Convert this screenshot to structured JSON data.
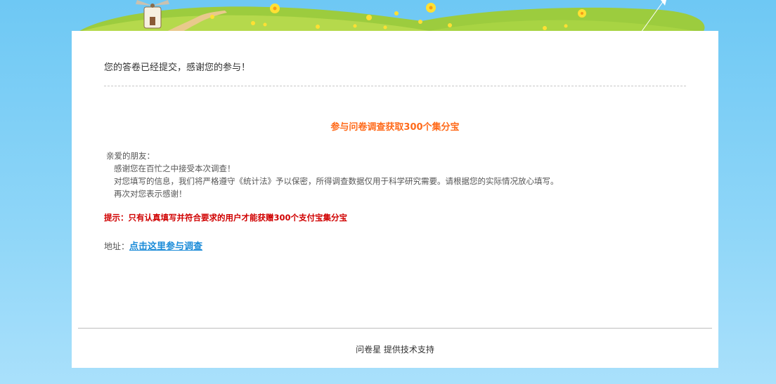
{
  "confirmation": {
    "message": "您的答卷已经提交，感谢您的参与！"
  },
  "promo": {
    "title": "参与问卷调查获取300个集分宝",
    "greeting": "亲爱的朋友：",
    "line1": "感谢您在百忙之中接受本次调查！",
    "line2": "对您填写的信息，我们将严格遵守《统计法》予以保密，所得调查数据仅用于科学研究需要。请根据您的实际情况放心填写。",
    "line3": "再次对您表示感谢！",
    "tip": "提示：只有认真填写并符合要求的用户才能获赠300个支付宝集分宝",
    "address_label": "地址：",
    "address_link": "点击这里参与调查"
  },
  "footer": {
    "text": "问卷星 提供技术支持"
  },
  "colors": {
    "background": "#8fd6f8",
    "promo_title": "#ff6a1a",
    "tip": "#d00000",
    "link": "#1a8bd8"
  }
}
